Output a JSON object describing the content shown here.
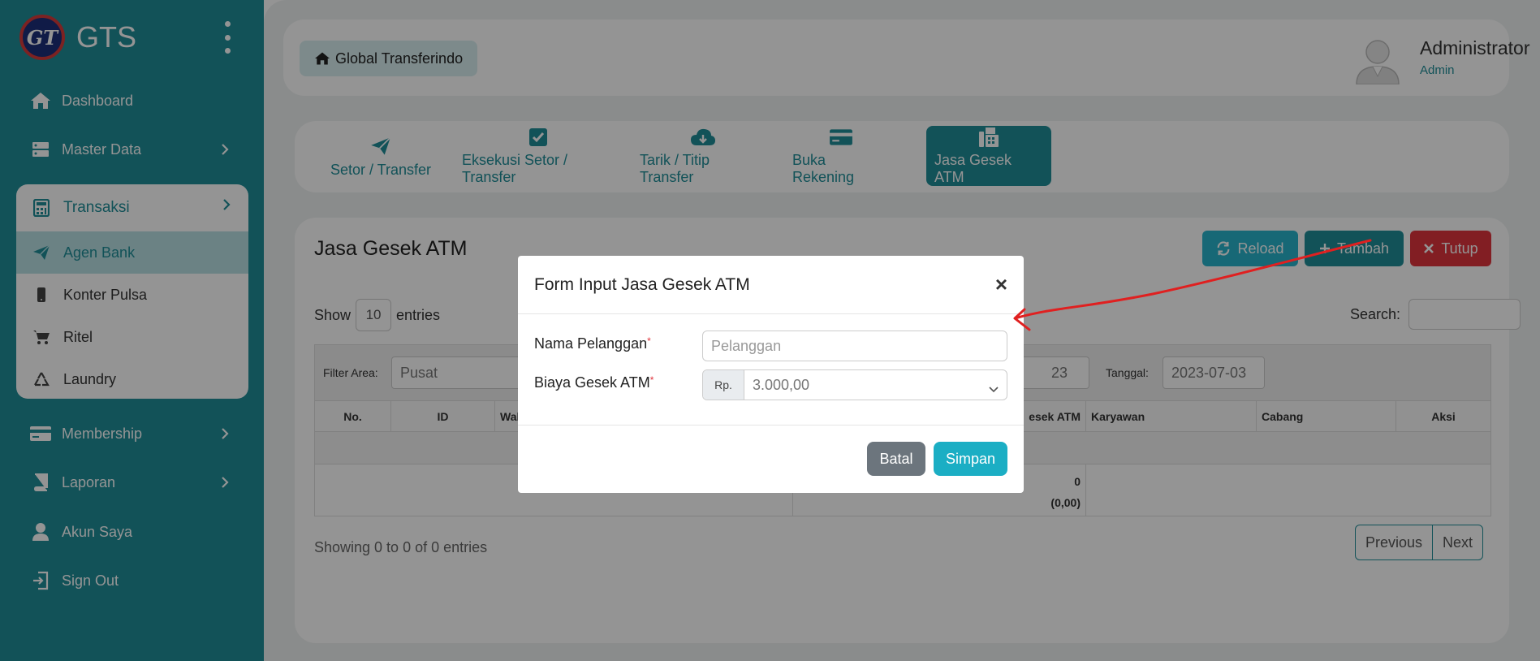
{
  "brand": {
    "name": "GTS",
    "logo_text": "GT"
  },
  "sidebar": {
    "items": [
      {
        "label": "Dashboard",
        "icon": "home-icon"
      },
      {
        "label": "Master Data",
        "icon": "server-icon"
      },
      {
        "label": "Transaksi",
        "icon": "calculator-icon"
      },
      {
        "label": "Membership",
        "icon": "credit-card-icon"
      },
      {
        "label": "Laporan",
        "icon": "book-icon"
      },
      {
        "label": "Akun Saya",
        "icon": "user-icon"
      },
      {
        "label": "Sign Out",
        "icon": "sign-out-icon"
      }
    ],
    "transaksi_sub": [
      {
        "label": "Agen Bank",
        "icon": "paper-plane-icon",
        "active": true
      },
      {
        "label": "Konter Pulsa",
        "icon": "mobile-icon"
      },
      {
        "label": "Ritel",
        "icon": "cart-icon"
      },
      {
        "label": "Laundry",
        "icon": "recycle-icon"
      }
    ]
  },
  "header": {
    "home_label": "Global Transferindo",
    "user_name": "Administrator",
    "user_role": "Admin"
  },
  "tabs": [
    {
      "label": "Setor / Transfer",
      "icon": "paper-plane-icon"
    },
    {
      "label": "Eksekusi Setor / Transfer",
      "icon": "check-square-icon"
    },
    {
      "label": "Tarik / Titip Transfer",
      "icon": "cloud-download-icon"
    },
    {
      "label": "Buka Rekening",
      "icon": "credit-card-icon"
    },
    {
      "label": "Jasa Gesek ATM",
      "icon": "fax-icon",
      "active": true
    }
  ],
  "card": {
    "title": "Jasa Gesek ATM",
    "reload_label": "Reload",
    "tambah_label": "Tambah",
    "tutup_label": "Tutup",
    "show_label": "Show",
    "entries_value": "10",
    "entries_label": "entries",
    "search_label": "Search:",
    "filter_area_label": "Filter Area:",
    "filter_area_value": "Pusat",
    "filter_hidden_value": "23",
    "tanggal_label": "Tanggal:",
    "tanggal_value": "2023-07-03",
    "columns": [
      "No.",
      "ID",
      "Wak",
      "esek ATM",
      "Karyawan",
      "Cabang",
      "Aksi"
    ],
    "total_count": "0",
    "total_amount": "(0,00)",
    "info": "Showing 0 to 0 of 0 entries",
    "prev_label": "Previous",
    "next_label": "Next"
  },
  "modal": {
    "title": "Form Input Jasa Gesek ATM",
    "close_label": "×",
    "nama_label": "Nama Pelanggan",
    "nama_placeholder": "Pelanggan",
    "biaya_label": "Biaya Gesek ATM",
    "required_mark": "*",
    "currency_prefix": "Rp.",
    "biaya_value": "3.000,00",
    "batal_label": "Batal",
    "simpan_label": "Simpan"
  },
  "colors": {
    "primary": "#1f8d98",
    "info": "#28b4cc",
    "danger": "#e0353d",
    "secondary": "#6c757d",
    "annotation_arrow": "#e02020"
  }
}
